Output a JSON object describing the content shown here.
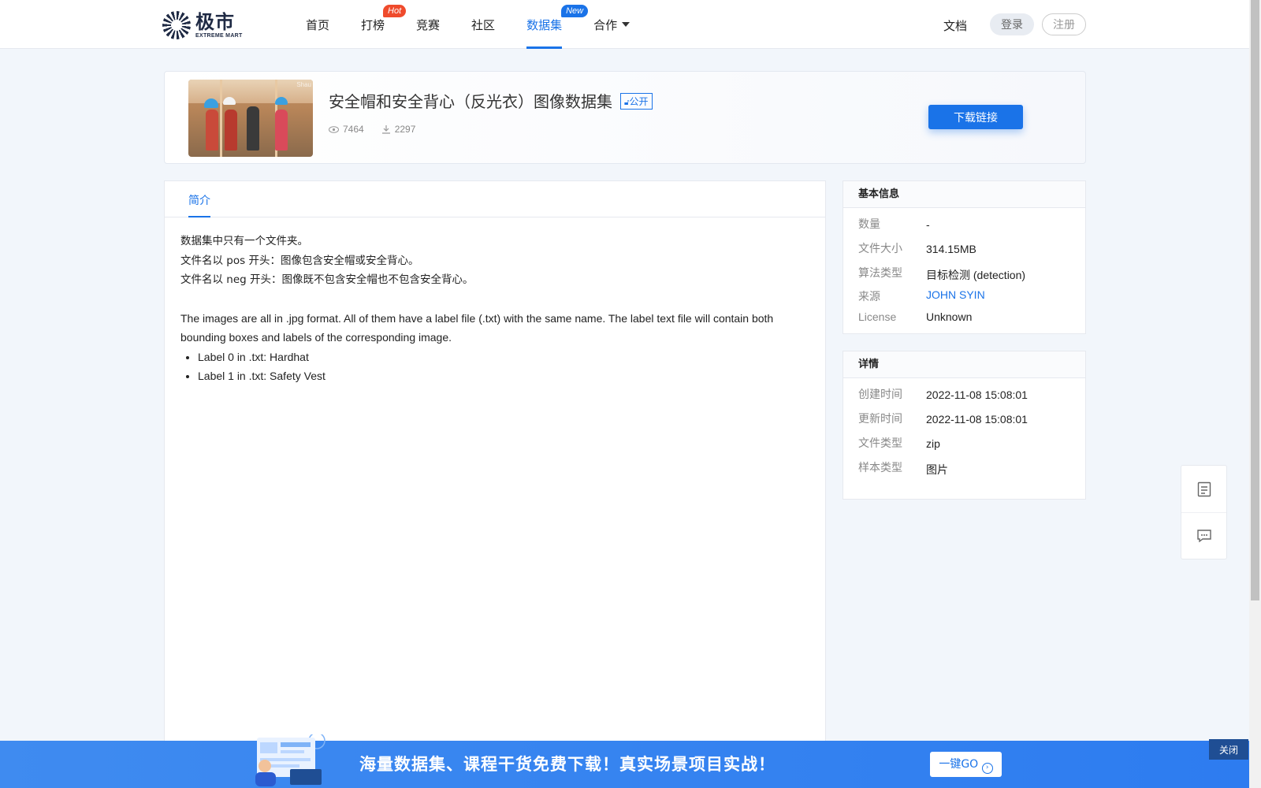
{
  "header": {
    "logo_cn": "极市",
    "logo_en": "EXTREME MART",
    "nav": [
      {
        "label": "首页"
      },
      {
        "label": "打榜",
        "badge": "Hot"
      },
      {
        "label": "竞赛"
      },
      {
        "label": "社区"
      },
      {
        "label": "数据集",
        "badge": "New",
        "active": true
      },
      {
        "label": "合作"
      }
    ],
    "docs": "文档",
    "login": "登录",
    "register": "注册"
  },
  "dataset": {
    "title": "安全帽和安全背心（反光衣）图像数据集",
    "visibility": "公开",
    "views": "7464",
    "downloads": "2297",
    "download_button": "下载链接",
    "thumb_watermark": "Shau"
  },
  "tabs": [
    {
      "label": "简介"
    }
  ],
  "intro": {
    "cn_lines": [
      "数据集中只有一个文件夹。",
      "文件名以 pos 开头：图像包含安全帽或安全背心。",
      "文件名以 neg 开头：图像既不包含安全帽也不包含安全背心。"
    ],
    "en_paragraph": "The images are all in .jpg format. All of them have a label file (.txt) with the same name. The label text file will contain both bounding boxes and labels of the corresponding image.",
    "bullets": [
      "Label 0 in .txt: Hardhat",
      "Label 1 in .txt: Safety Vest"
    ]
  },
  "basic_info": {
    "title": "基本信息",
    "rows": [
      {
        "key": "数量",
        "value": "-"
      },
      {
        "key": "文件大小",
        "value": "314.15MB"
      },
      {
        "key": "算法类型",
        "value": "目标检测 (detection)"
      },
      {
        "key": "来源",
        "value": "JOHN SYIN"
      },
      {
        "key": "License",
        "value": "Unknown"
      }
    ]
  },
  "details": {
    "title": "详情",
    "rows": [
      {
        "key": "创建时间",
        "value": "2022-11-08 15:08:01"
      },
      {
        "key": "更新时间",
        "value": "2022-11-08 15:08:01"
      },
      {
        "key": "文件类型",
        "value": "zip"
      },
      {
        "key": "样本类型",
        "value": "图片"
      }
    ]
  },
  "tools": [
    "document-icon",
    "comment-icon"
  ],
  "banner": {
    "text": "海量数据集、课程干货免费下载！真实场景项目实战！",
    "go": "一键GO",
    "close": "关闭"
  },
  "colors": {
    "accent": "#1a73e8",
    "hot": "#ef4b2c",
    "banner": "#3f8bf0",
    "page_bg": "#f2f6fb"
  }
}
